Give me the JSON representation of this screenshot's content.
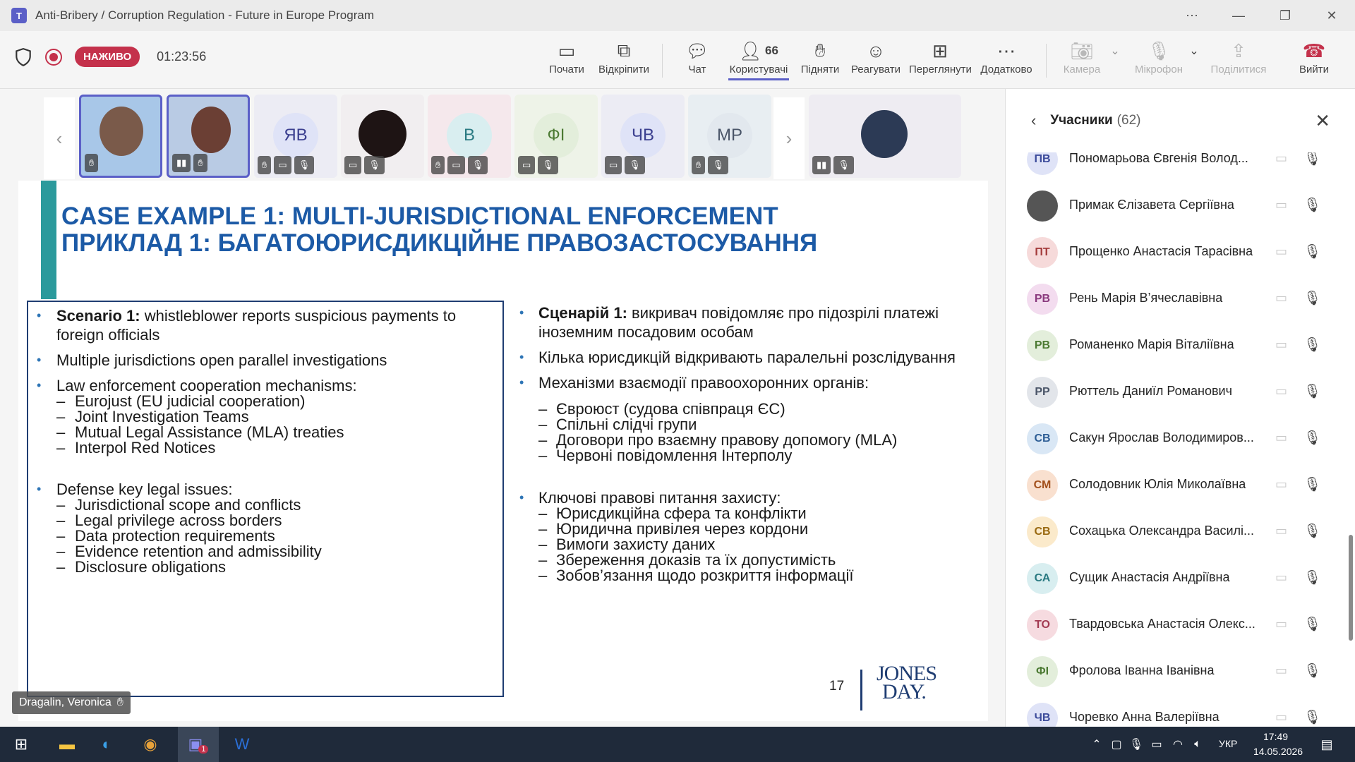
{
  "window": {
    "title": "Anti-Bribery / Corruption Regulation - Future in Europe Program"
  },
  "meeting": {
    "live_label": "НАЖИВО",
    "timer": "01:23:56",
    "buttons": {
      "start": "Почати",
      "unpin": "Відкріпити",
      "chat": "Чат",
      "people": "Користувачі",
      "people_count": "66",
      "raise": "Підняти",
      "react": "Реагувати",
      "view": "Переглянути",
      "more": "Додатково",
      "camera": "Камера",
      "mic": "Мікрофон",
      "share": "Поділитися",
      "leave": "Вийти"
    }
  },
  "video_tiles": [
    {
      "initials": "ЯВ"
    },
    {
      "initials": "В"
    },
    {
      "initials": "ФІ"
    },
    {
      "initials": "ЧВ"
    },
    {
      "initials": "МР"
    }
  ],
  "slide": {
    "title_en": "CASE EXAMPLE 1: MULTI-JURISDICTIONAL ENFORCEMENT",
    "title_uk": "ПРИКЛАД 1: БАГАТОЮРИСДИКЦІЙНЕ ПРАВОЗАСТОСУВАННЯ",
    "en": {
      "s1_bold": "Scenario 1:",
      "s1_l1": " whistleblower reports suspicious payments to",
      "s1_l2": "foreign officials",
      "b2": "Multiple jurisdictions open parallel investigations",
      "b3": "Law enforcement cooperation mechanisms:",
      "b3_subs": [
        "Eurojust (EU judicial cooperation)",
        "Joint Investigation Teams",
        "Mutual Legal Assistance (MLA) treaties",
        "Interpol Red Notices"
      ],
      "b4": "Defense key legal issues:",
      "b4_subs": [
        "Jurisdictional scope and conflicts",
        "Legal privilege across borders",
        "Data protection requirements",
        "Evidence retention and admissibility",
        "Disclosure obligations"
      ]
    },
    "uk": {
      "s1_bold": "Сценарій 1:",
      "s1_l1": " викривач повідомляє про підозрілі платежі",
      "s1_l2": "іноземним посадовим особам",
      "b2": "Кілька юрисдикцій відкривають паралельні розслідування",
      "b3": "Механізми взаємодії правоохоронних органів:",
      "b3_subs": [
        "Євроюст (судова співпраця ЄС)",
        "Спільні слідчі групи",
        "Договори про взаємну правову допомогу (MLA)",
        "Червоні повідомлення Інтерполу"
      ],
      "b4": "Ключові правові питання захисту:",
      "b4_subs": [
        "Юрисдикційна сфера та конфлікти",
        "Юридична привілея через кордони",
        "Вимоги захисту даних",
        "Збереження доказів та їх допустимість",
        "Зобов’язання щодо розкриття інформації"
      ]
    },
    "page_number": "17",
    "logo_line1": "JONES",
    "logo_line2": "DAY."
  },
  "presenter_name": "Dragalin, Veronica",
  "participants_panel": {
    "title": "Учасники",
    "count": "(62)",
    "rows": [
      {
        "initials": "ПВ",
        "name": "Пономарьова Євгенія Волод...",
        "bg": "#dfe3f7",
        "fg": "#3b4a9a"
      },
      {
        "initials": "",
        "name": "Примак Єлізавета Сергіївна",
        "bg": "#555555",
        "fg": "#ffffff"
      },
      {
        "initials": "ПТ",
        "name": "Прощенко Анастасія Тарасівна",
        "bg": "#f6dada",
        "fg": "#a33b3b"
      },
      {
        "initials": "РВ",
        "name": "Рень Марія В’ячеславівна",
        "bg": "#f3dcef",
        "fg": "#8a3a7e"
      },
      {
        "initials": "РВ",
        "name": "Романенко Марія Віталіївна",
        "bg": "#e3eedb",
        "fg": "#4c7a33"
      },
      {
        "initials": "РР",
        "name": "Рюттель Даниїл Романович",
        "bg": "#e2e5ea",
        "fg": "#4a5568"
      },
      {
        "initials": "СВ",
        "name": "Сакун Ярослав Володимиров...",
        "bg": "#d9e7f5",
        "fg": "#2f5f96"
      },
      {
        "initials": "СМ",
        "name": "Солодовник Юлія Миколаївна",
        "bg": "#f9e0cf",
        "fg": "#a3501c"
      },
      {
        "initials": "СВ",
        "name": "Сохацька Олександра Василі...",
        "bg": "#fbeacb",
        "fg": "#9a6a12"
      },
      {
        "initials": "СА",
        "name": "Сущик Анастасія Андріївна",
        "bg": "#d8eef0",
        "fg": "#2a7a82"
      },
      {
        "initials": "ТО",
        "name": "Твардовська Анастасія Олекс...",
        "bg": "#f6dbe0",
        "fg": "#a33a52"
      },
      {
        "initials": "ФІ",
        "name": "Фролова Іванна Іванівна",
        "bg": "#e3eedb",
        "fg": "#4c7a33"
      },
      {
        "initials": "ЧВ",
        "name": "Чоревко Анна Валеріївна",
        "bg": "#dfe3f7",
        "fg": "#3b4a9a"
      }
    ]
  },
  "taskbar": {
    "language": "УКР",
    "time": "17:49",
    "date": "14.05.2026",
    "teams_badge": "1"
  }
}
